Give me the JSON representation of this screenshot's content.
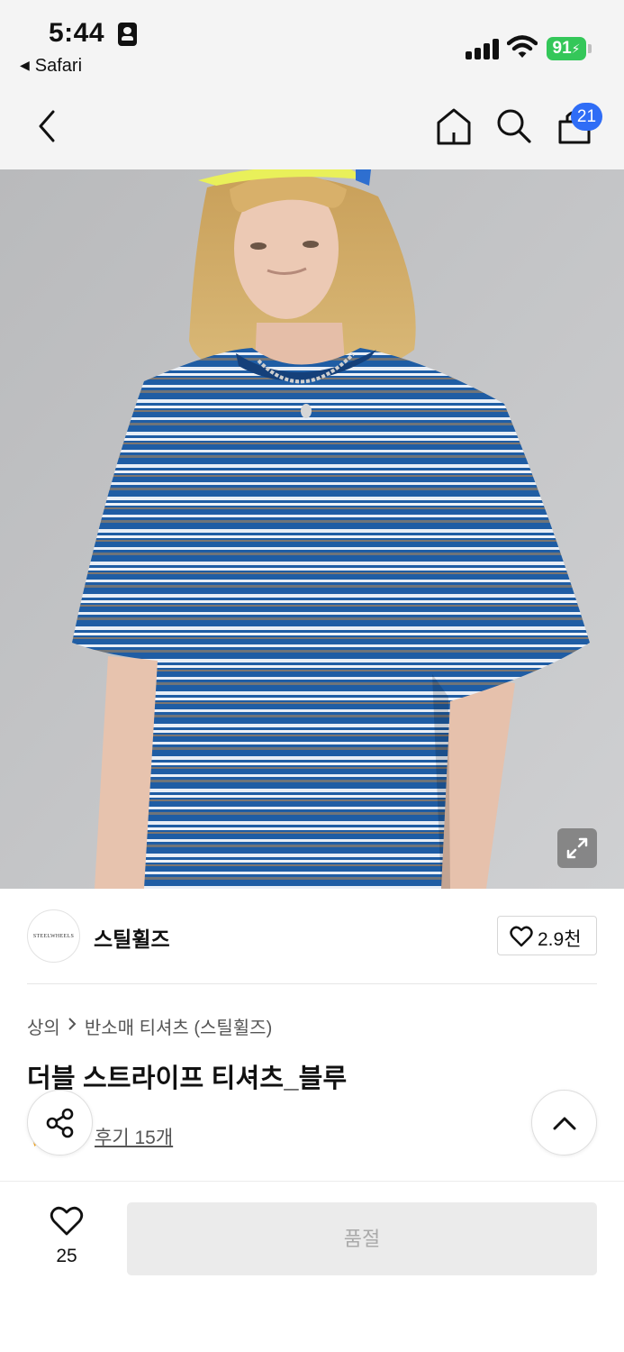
{
  "status_bar": {
    "time": "5:44",
    "back_app": "Safari",
    "battery": "91",
    "battery_color": "#34c759"
  },
  "header": {
    "cart_count": "21",
    "badge_color": "#2f6df6",
    "icons": [
      "back-icon",
      "home-icon",
      "search-icon",
      "cart-icon"
    ]
  },
  "product": {
    "image_alt": "product-photo-striped-tshirt",
    "brand": {
      "logo_text": "STEELWHEELS",
      "name": "스틸휠즈",
      "likes": "2.9천"
    },
    "breadcrumb": [
      "상의",
      "반소매 티셔츠 (스틸휠즈)"
    ],
    "title": "더블 스트라이프 티셔츠_블루",
    "review_link": "후기 15개"
  },
  "bottom_bar": {
    "wish_count": "25",
    "buy_label": "품절"
  }
}
